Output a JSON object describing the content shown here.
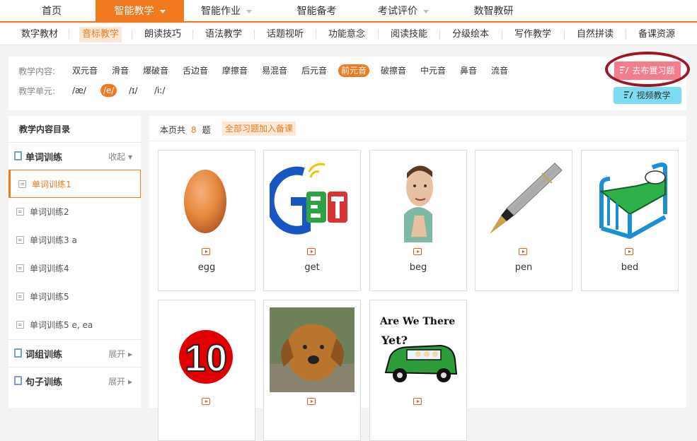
{
  "top_nav": [
    {
      "label": "首页",
      "dropdown": false,
      "active": false
    },
    {
      "label": "智能教学",
      "dropdown": true,
      "active": true
    },
    {
      "label": "智能作业",
      "dropdown": true,
      "active": false
    },
    {
      "label": "智能备考",
      "dropdown": false,
      "active": false
    },
    {
      "label": "考试评价",
      "dropdown": true,
      "active": false
    },
    {
      "label": "数智教研",
      "dropdown": false,
      "active": false
    }
  ],
  "sub_nav": [
    "数字教材",
    "音标教学",
    "朗读技巧",
    "语法教学",
    "话题视听",
    "功能意念",
    "阅读技能",
    "分级绘本",
    "写作教学",
    "自然拼读",
    "备课资源"
  ],
  "filter": {
    "content_label": "教学内容:",
    "content_items": [
      "双元音",
      "滑音",
      "爆破音",
      "舌边音",
      "摩擦音",
      "易混音",
      "后元音",
      "前元音",
      "破擦音",
      "中元音",
      "鼻音",
      "流音"
    ],
    "unit_label": "教学单元:",
    "unit_items": [
      "/æ/",
      "/e/",
      "/ɪ/",
      "/iː/"
    ]
  },
  "actions": {
    "assign": "去布置习题",
    "video": "视频教学"
  },
  "sidebar": {
    "title": "教学内容目录",
    "groups": [
      {
        "label": "单词训练",
        "toggle": "收起"
      },
      {
        "label": "词组训练",
        "toggle": "展开"
      },
      {
        "label": "句子训练",
        "toggle": "展开"
      }
    ],
    "items": [
      "单词训练1",
      "单词训练2",
      "单词训练3 a",
      "单词训练4",
      "单词训练5",
      "单词训练5 e, ea"
    ]
  },
  "main": {
    "count_prefix": "本页共",
    "count": "8",
    "count_suffix": "题",
    "add_all": "全部习题加入备课"
  },
  "cards": [
    {
      "word": "egg",
      "icon": "egg-image"
    },
    {
      "word": "get",
      "icon": "get-logo-image"
    },
    {
      "word": "beg",
      "icon": "begging-man-image"
    },
    {
      "word": "pen",
      "icon": "fountain-pen-image"
    },
    {
      "word": "bed",
      "icon": "bed-image"
    },
    {
      "word": "",
      "icon": "number-ten-image",
      "numeral": "10"
    },
    {
      "word": "",
      "icon": "wet-dog-image"
    },
    {
      "word": "",
      "icon": "car-cartoon-image",
      "caption_line1": "Are We There",
      "caption_line2": "Yet?"
    }
  ],
  "colors": {
    "accent": "#f07a1d",
    "assign_button": "#f47d8a",
    "video_button": "#7ddcf2",
    "annotation_circle": "#9c1524"
  }
}
